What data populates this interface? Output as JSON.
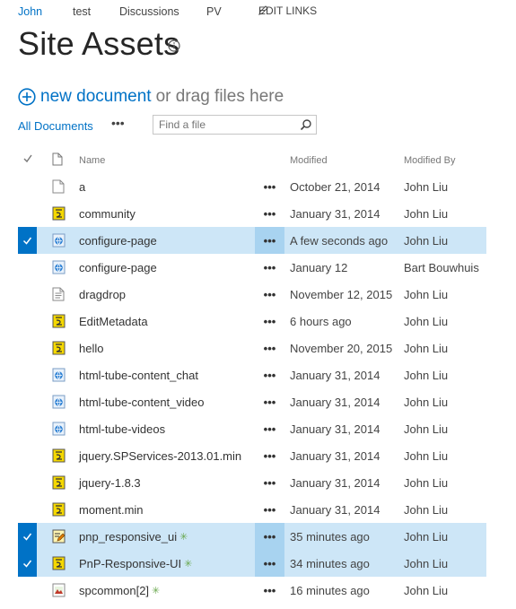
{
  "nav": {
    "items": [
      "John",
      "test",
      "Discussions",
      "PV"
    ],
    "edit_links": "EDIT LINKS"
  },
  "page": {
    "title": "Site Assets"
  },
  "command": {
    "new_document": "new document",
    "drag_hint": "or drag files here"
  },
  "view": {
    "name": "All Documents",
    "search_placeholder": "Find a file"
  },
  "columns": {
    "name": "Name",
    "modified": "Modified",
    "modified_by": "Modified By"
  },
  "rows": [
    {
      "name": "a",
      "icon": "blank-file-icon",
      "modified": "October 21, 2014",
      "by": "John Liu",
      "selected": false,
      "is_new": false
    },
    {
      "name": "community",
      "icon": "script-file-icon",
      "modified": "January 31, 2014",
      "by": "John Liu",
      "selected": false,
      "is_new": false
    },
    {
      "name": "configure-page",
      "icon": "html-file-icon",
      "modified": "A few seconds ago",
      "by": "John Liu",
      "selected": true,
      "is_new": false
    },
    {
      "name": "configure-page",
      "icon": "html-file-icon",
      "modified": "January 12",
      "by": "Bart Bouwhuis",
      "selected": false,
      "is_new": false
    },
    {
      "name": "dragdrop",
      "icon": "text-file-icon",
      "modified": "November 12, 2015",
      "by": "John Liu",
      "selected": false,
      "is_new": false
    },
    {
      "name": "EditMetadata",
      "icon": "script-file-icon",
      "modified": "6 hours ago",
      "by": "John Liu",
      "selected": false,
      "is_new": false
    },
    {
      "name": "hello",
      "icon": "script-file-icon",
      "modified": "November 20, 2015",
      "by": "John Liu",
      "selected": false,
      "is_new": false
    },
    {
      "name": "html-tube-content_chat",
      "icon": "html-file-icon",
      "modified": "January 31, 2014",
      "by": "John Liu",
      "selected": false,
      "is_new": false
    },
    {
      "name": "html-tube-content_video",
      "icon": "html-file-icon",
      "modified": "January 31, 2014",
      "by": "John Liu",
      "selected": false,
      "is_new": false
    },
    {
      "name": "html-tube-videos",
      "icon": "html-file-icon",
      "modified": "January 31, 2014",
      "by": "John Liu",
      "selected": false,
      "is_new": false
    },
    {
      "name": "jquery.SPServices-2013.01.min",
      "icon": "script-file-icon",
      "modified": "January 31, 2014",
      "by": "John Liu",
      "selected": false,
      "is_new": false
    },
    {
      "name": "jquery-1.8.3",
      "icon": "script-file-icon",
      "modified": "January 31, 2014",
      "by": "John Liu",
      "selected": false,
      "is_new": false
    },
    {
      "name": "moment.min",
      "icon": "script-file-icon",
      "modified": "January 31, 2014",
      "by": "John Liu",
      "selected": false,
      "is_new": false
    },
    {
      "name": "pnp_responsive_ui",
      "icon": "edit-script-file-icon",
      "modified": "35 minutes ago",
      "by": "John Liu",
      "selected": true,
      "is_new": true
    },
    {
      "name": "PnP-Responsive-UI",
      "icon": "script-file-icon",
      "modified": "34 minutes ago",
      "by": "John Liu",
      "selected": true,
      "is_new": true
    },
    {
      "name": "spcommon[2]",
      "icon": "image-file-icon",
      "modified": "16 minutes ago",
      "by": "John Liu",
      "selected": false,
      "is_new": true
    }
  ],
  "colors": {
    "accent": "#0072c6",
    "selected_row": "#cde6f7",
    "new_star": "#6aa84f"
  }
}
